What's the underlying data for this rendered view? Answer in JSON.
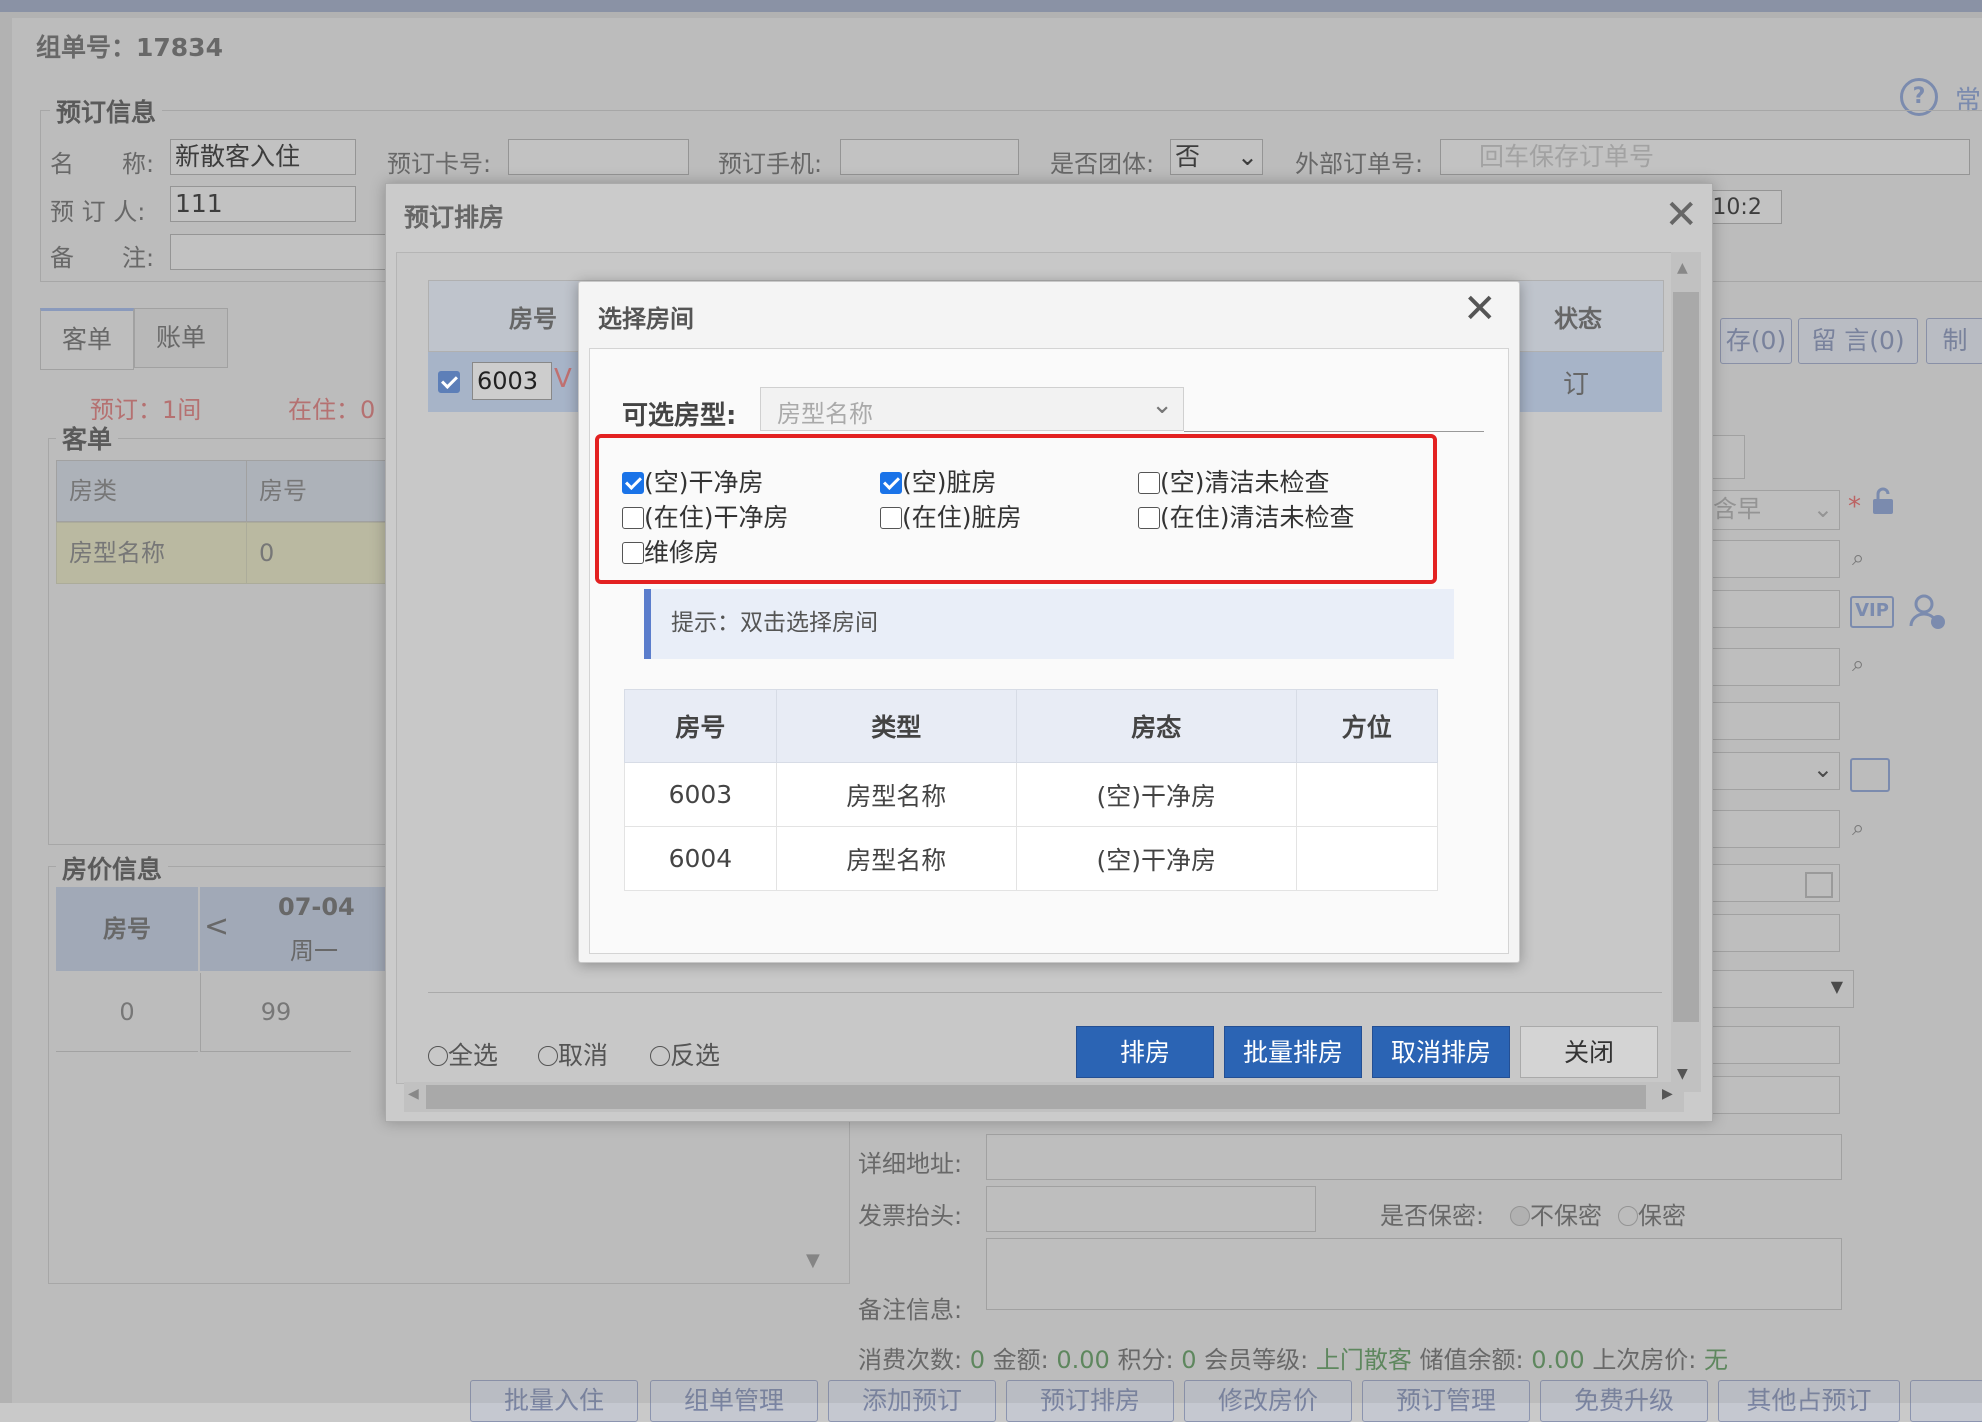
{
  "background": {
    "group_no": "组单号：17834",
    "booking_legend": "预订信息",
    "name_label": "名　　称:",
    "name_value": "新散客入住",
    "booker_label": "预 订 人:",
    "booker_value": "111",
    "remark_label": "备　　注:",
    "card_label": "预订卡号:",
    "phone_label": "预订手机:",
    "group_label": "是否团体:",
    "group_value": "否",
    "external_label": "外部订单号:",
    "external_placeholder": "回车保存订单号",
    "time_fragment": ":10:2",
    "tabs": [
      "客单",
      "账单"
    ],
    "booked_text": "预订：1间",
    "living_text": "在住：0",
    "guest_legend": "客单",
    "guest_table_headers": [
      "房类",
      "房号"
    ],
    "guest_table_row": [
      "房型名称",
      "0"
    ],
    "price_legend": "房价信息",
    "price_header_room": "房号",
    "price_header_date": "07-04",
    "price_header_weekday": "周一",
    "price_row": [
      "0",
      "99"
    ],
    "right_buttons": [
      "存(0)",
      "留 言(0)",
      "制"
    ],
    "side_text": "含早",
    "vip_label": "VIP",
    "address_label": "详细地址:",
    "invoice_label": "发票抬头:",
    "secret_label": "是否保密:",
    "secret_options": [
      "不保密",
      "保密"
    ],
    "remark_info_label": "备注信息:",
    "stats": {
      "consume_label": "消费次数:",
      "consume_value": "0",
      "amount_label": "金额:",
      "amount_value": "0.00",
      "points_label": "积分:",
      "points_value": "0",
      "level_label": "会员等级:",
      "level_value": "上门散客",
      "balance_label": "储值余额:",
      "balance_value": "0.00",
      "last_price_label": "上次房价:",
      "last_price_value": "无"
    },
    "bottom_buttons": [
      "批量入住",
      "组单管理",
      "添加预订",
      "预订排房",
      "修改房价",
      "预订管理",
      "免费升级",
      "其他占预订"
    ],
    "help_text": "常"
  },
  "dialog_arrange": {
    "title": "预订排房",
    "col_room": "房号",
    "col_status": "状态",
    "row_room": "6003",
    "row_status": "订",
    "row_fragment": "V",
    "select_options": [
      "全选",
      "取消",
      "反选"
    ],
    "buttons": [
      "排房",
      "批量排房",
      "取消排房",
      "关闭"
    ]
  },
  "dialog_select": {
    "title": "选择房间",
    "type_label": "可选房型:",
    "type_placeholder": "房型名称",
    "filters": [
      {
        "label": "(空)干净房",
        "checked": true
      },
      {
        "label": "(空)脏房",
        "checked": true
      },
      {
        "label": "(空)清洁未检查",
        "checked": false
      },
      {
        "label": "(在住)干净房",
        "checked": false
      },
      {
        "label": "(在住)脏房",
        "checked": false
      },
      {
        "label": "(在住)清洁未检查",
        "checked": false
      },
      {
        "label": "维修房",
        "checked": false
      }
    ],
    "hint": "提示：双击选择房间",
    "headers": [
      "房号",
      "类型",
      "房态",
      "方位"
    ],
    "rows": [
      [
        "6003",
        "房型名称",
        "(空)干净房",
        ""
      ],
      [
        "6004",
        "房型名称",
        "(空)干净房",
        ""
      ]
    ]
  },
  "colors": {
    "primary_button": "#2b64b4",
    "highlight_box": "#e32121",
    "checkbox_on": "#1a73e8"
  }
}
